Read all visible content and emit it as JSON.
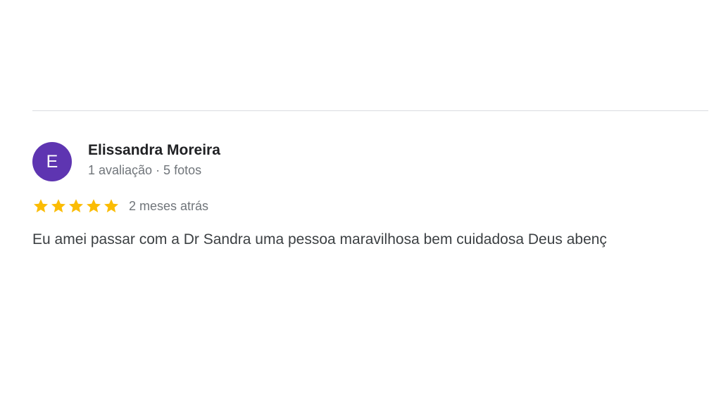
{
  "review": {
    "avatar_letter": "E",
    "avatar_color": "#5e35b1",
    "author_name": "Elissandra Moreira",
    "author_meta": "1 avaliação · 5 fotos",
    "rating": 5,
    "rating_max": 5,
    "star_color": "#fbbc04",
    "icons": [
      "star-icon"
    ],
    "date": "2 meses atrás",
    "text": "Eu amei passar com a Dr Sandra uma pessoa maravilhosa bem cuidadosa Deus abenç"
  }
}
